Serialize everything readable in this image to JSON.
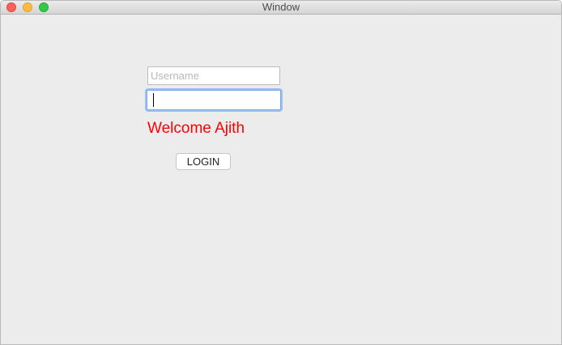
{
  "window": {
    "title": "Window"
  },
  "form": {
    "username_placeholder": "Username",
    "username_value": "",
    "password_value": "",
    "welcome_message": "Welcome Ajith",
    "login_label": "LOGIN"
  },
  "colors": {
    "welcome_text": "#ff0000",
    "focus_ring": "#9cc0f2",
    "traffic_close": "#fc605c",
    "traffic_minimize": "#fdbc40",
    "traffic_zoom": "#34c84a"
  }
}
